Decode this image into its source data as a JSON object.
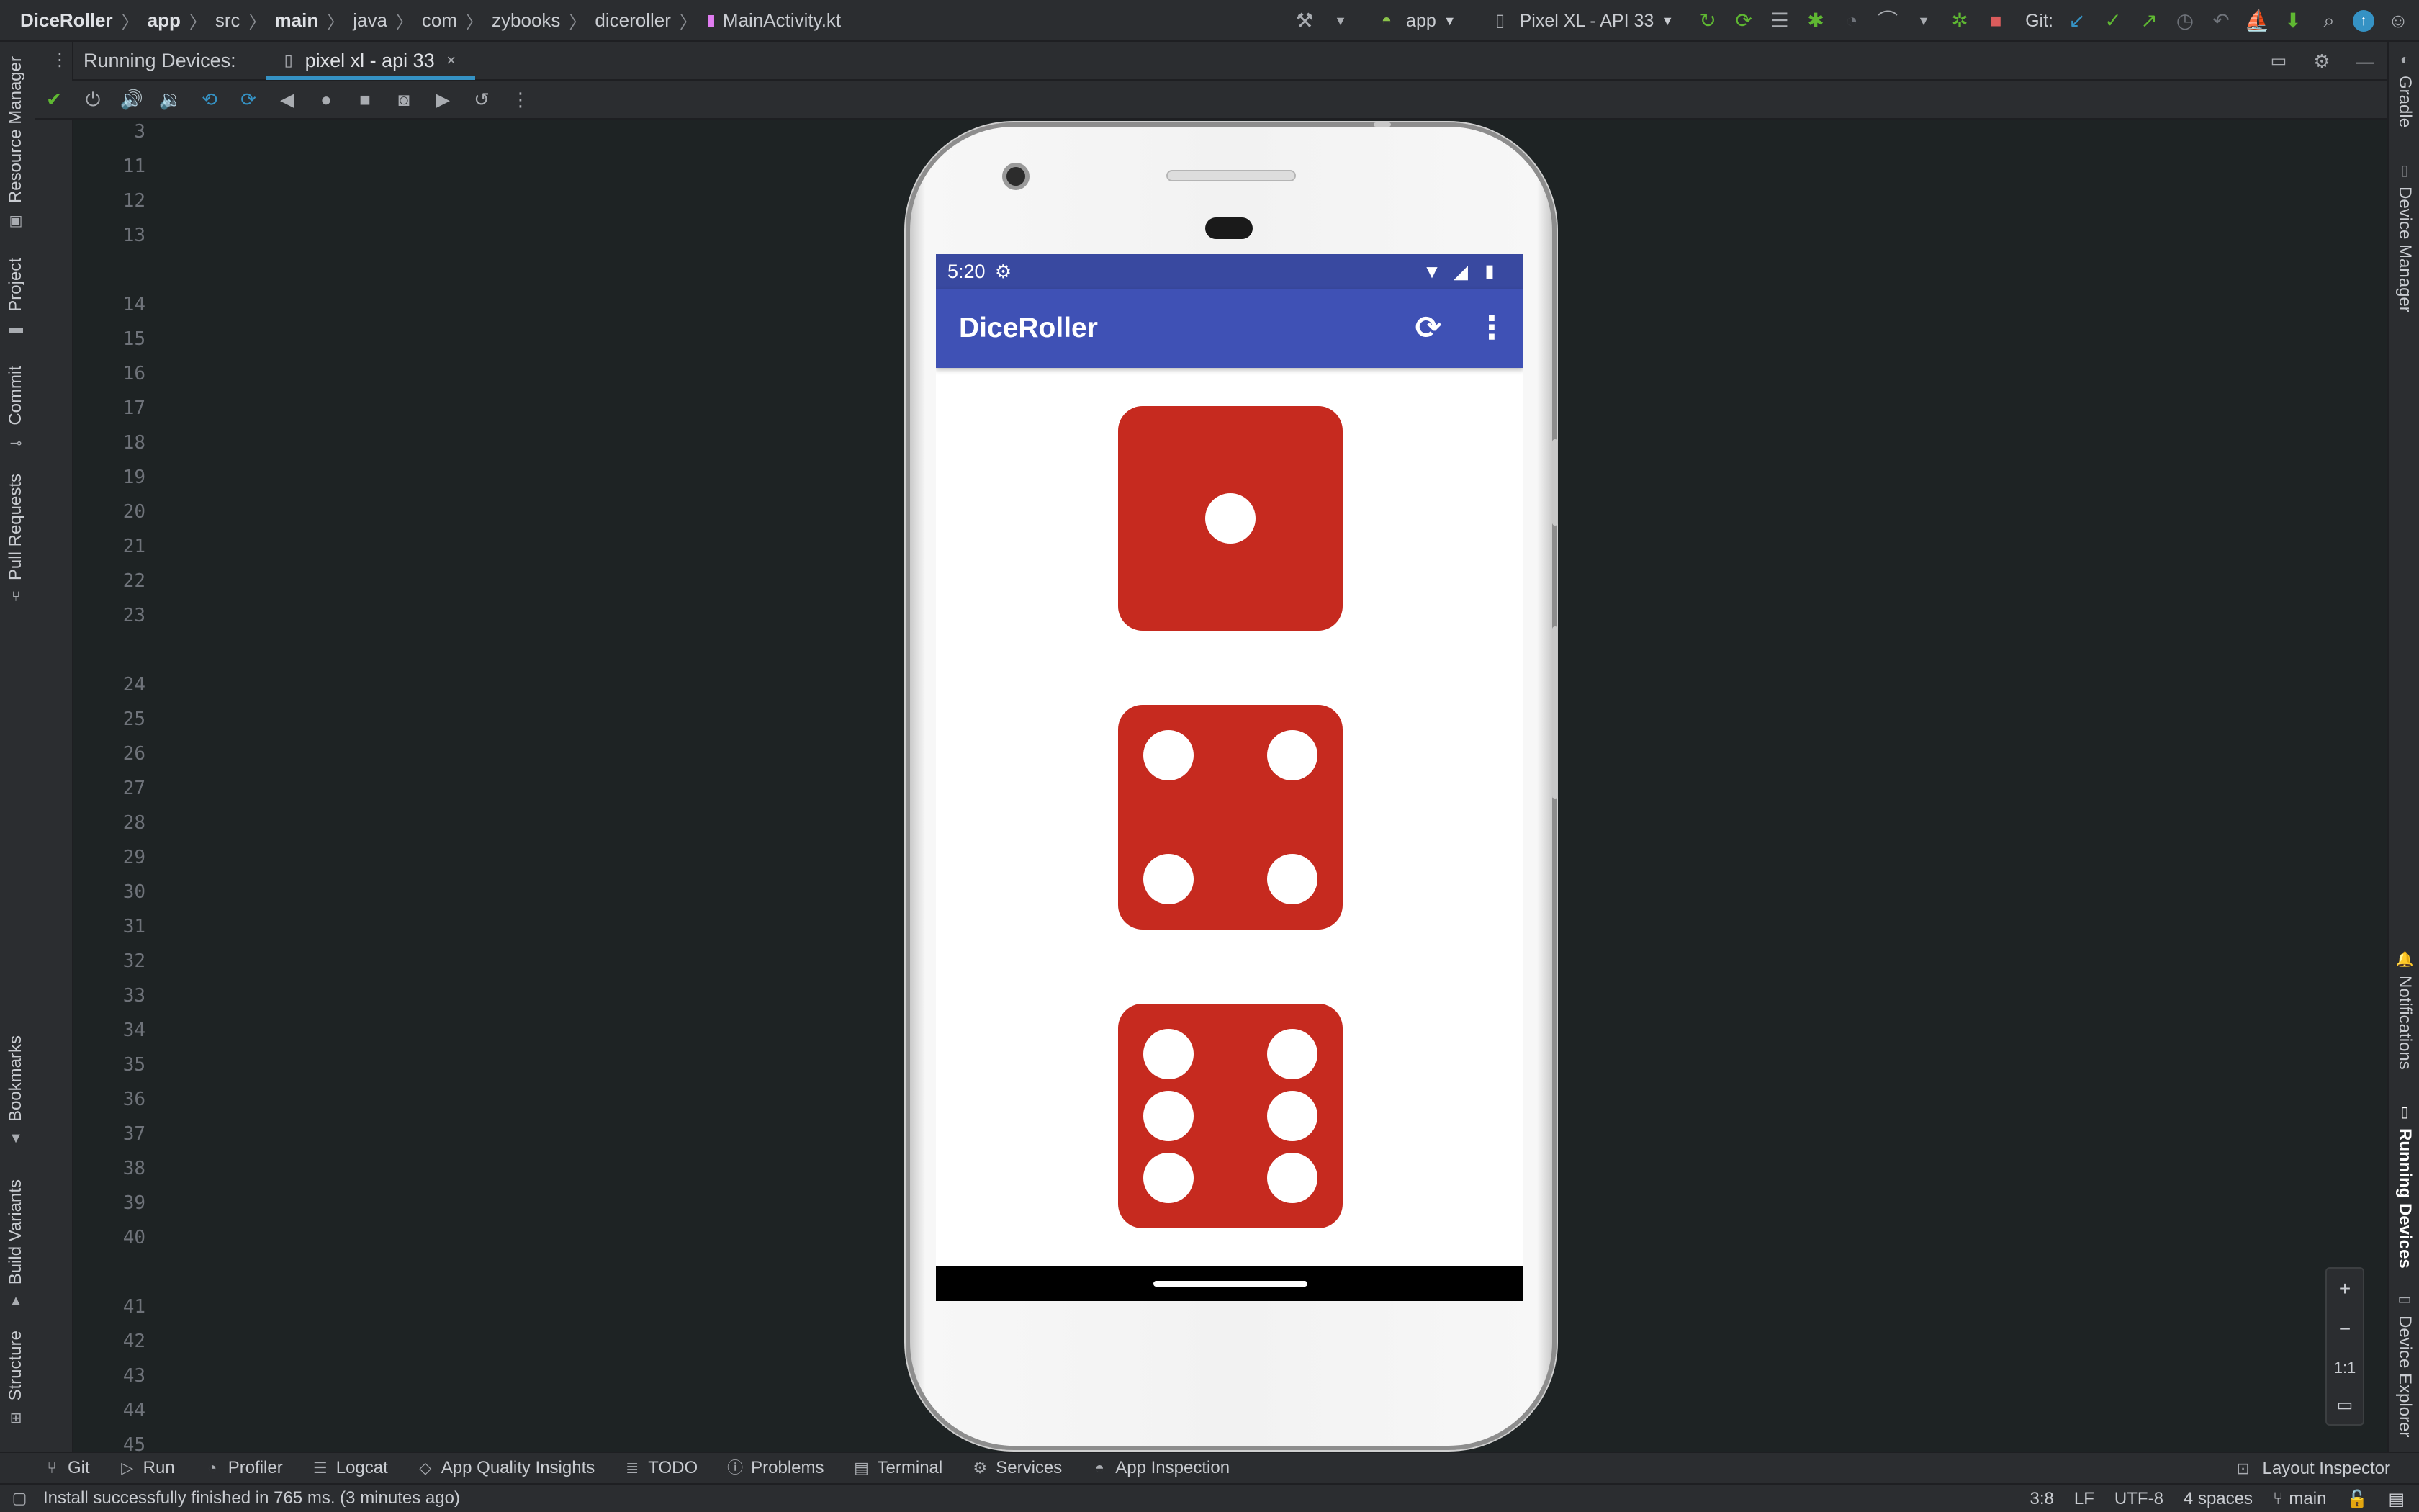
{
  "ide": {
    "breadcrumbs": [
      "DiceRoller",
      "app",
      "src",
      "main",
      "java",
      "com",
      "zybooks",
      "diceroller",
      "MainActivity.kt"
    ],
    "run_config": "app",
    "device_selector": "Pixel XL - API 33",
    "git_label": "Git:",
    "running_devices_label": "Running Devices:",
    "device_tab_label": "pixel xl - api 33",
    "line_numbers": [
      "3",
      "11",
      "12",
      "13",
      "14",
      "15",
      "16",
      "17",
      "18",
      "19",
      "20",
      "21",
      "22",
      "23",
      "24",
      "25",
      "26",
      "27",
      "28",
      "29",
      "30",
      "31",
      "32",
      "33",
      "34",
      "35",
      "36",
      "37",
      "38",
      "39",
      "40",
      "41",
      "42",
      "43",
      "44",
      "45"
    ],
    "left_tool_windows": [
      "Resource Manager",
      "Project",
      "Commit",
      "Pull Requests",
      "Bookmarks",
      "Build Variants",
      "Structure"
    ],
    "right_tool_windows": [
      "Gradle",
      "Device Manager",
      "Notifications",
      "Running Devices",
      "Device Explorer"
    ],
    "zoom_controls": [
      "+",
      "−",
      "1:1"
    ],
    "bottom_tabs": [
      "Git",
      "Run",
      "Profiler",
      "Logcat",
      "App Quality Insights",
      "TODO",
      "Problems",
      "Terminal",
      "Services",
      "App Inspection"
    ],
    "layout_inspector_label": "Layout Inspector",
    "status_message": "Install successfully finished in 765 ms. (3 minutes ago)",
    "status_right": {
      "position": "3:8",
      "line_sep": "LF",
      "encoding": "UTF-8",
      "indent": "4 spaces",
      "branch": "main"
    }
  },
  "device": {
    "status_time": "5:20",
    "app_title": "DiceRoller",
    "dice_values": [
      1,
      4,
      6
    ],
    "die_color": "#c62a1f",
    "appbar_color": "#3f51b5",
    "statusbar_color": "#3949a0"
  },
  "icons": {
    "top_actions": [
      "hammer-icon",
      "run-icon",
      "apply-changes-icon",
      "apply-code-changes-icon",
      "list-icon",
      "debug-icon",
      "profile-icon",
      "attach-icon",
      "sync-icon",
      "stop-icon"
    ],
    "git_actions": [
      "update-icon",
      "commit-icon",
      "push-icon",
      "history-icon",
      "rollback-icon"
    ]
  }
}
